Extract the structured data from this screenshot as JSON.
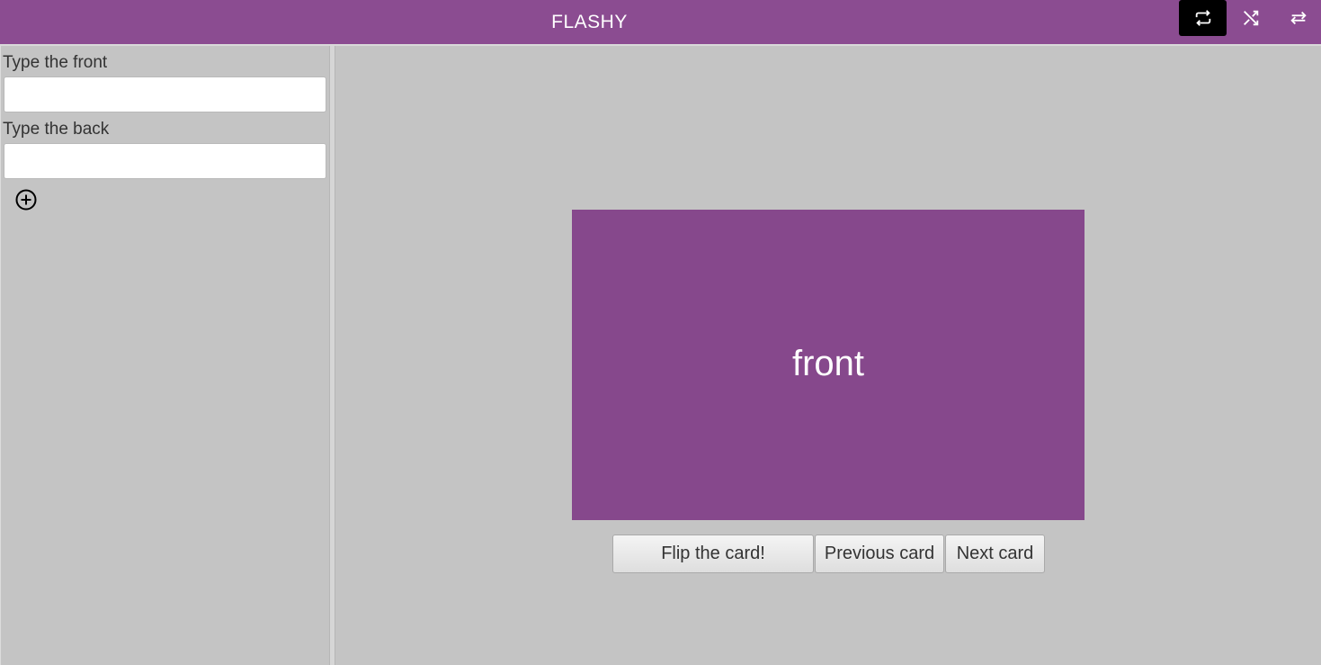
{
  "header": {
    "title": "FLASHY",
    "mode_buttons": [
      {
        "icon": "repeat-icon",
        "active": true
      },
      {
        "icon": "shuffle-icon",
        "active": false
      },
      {
        "icon": "swap-icon",
        "active": false
      }
    ]
  },
  "sidebar": {
    "front_label": "Type the front",
    "front_value": "",
    "back_label": "Type the back",
    "back_value": "",
    "add_icon": "add-circle-icon"
  },
  "card": {
    "text": "front"
  },
  "controls": {
    "flip_label": "Flip the card!",
    "previous_label": "Previous card",
    "next_label": "Next card"
  },
  "colors": {
    "accent": "#8b4c91",
    "card": "#86488c",
    "background": "#c4c4c4"
  }
}
